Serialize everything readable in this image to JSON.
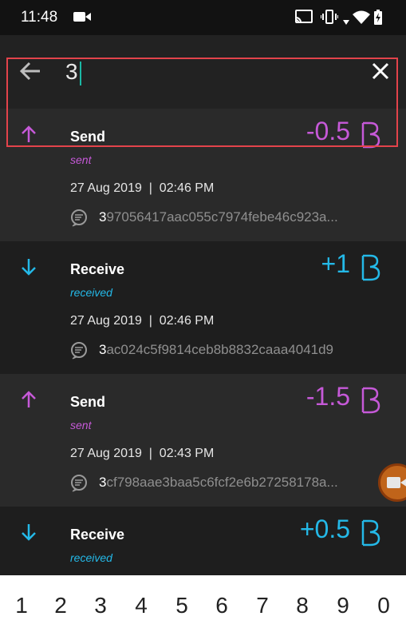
{
  "status_bar": {
    "time": "11:48"
  },
  "search": {
    "query": "3"
  },
  "transactions": [
    {
      "type": "send",
      "title": "Send",
      "status": "sent",
      "date": "27 Aug 2019  |  02:46 PM",
      "hash_prefix": "3",
      "hash_rest": "97056417aac055c7974febe46c923a...",
      "amount": "-0.5"
    },
    {
      "type": "receive",
      "title": "Receive",
      "status": "received",
      "date": "27 Aug 2019  |  02:46 PM",
      "hash_prefix": "3",
      "hash_rest": "ac024c5f9814ceb8b8832caaa4041d9",
      "amount": "+1"
    },
    {
      "type": "send",
      "title": "Send",
      "status": "sent",
      "date": "27 Aug 2019  |  02:43 PM",
      "hash_prefix": "3",
      "hash_rest": "cf798aae3baa5c6fcf2e6b27258178a...",
      "amount": "-1.5"
    },
    {
      "type": "receive",
      "title": "Receive",
      "status": "received",
      "date": "",
      "hash_prefix": "",
      "hash_rest": "",
      "amount": "+0.5"
    }
  ],
  "keyboard": {
    "keys": [
      "1",
      "2",
      "3",
      "4",
      "5",
      "6",
      "7",
      "8",
      "9",
      "0"
    ]
  },
  "colors": {
    "send": "#c659d8",
    "receive": "#24b9e8",
    "highlight": "#e3434b"
  }
}
